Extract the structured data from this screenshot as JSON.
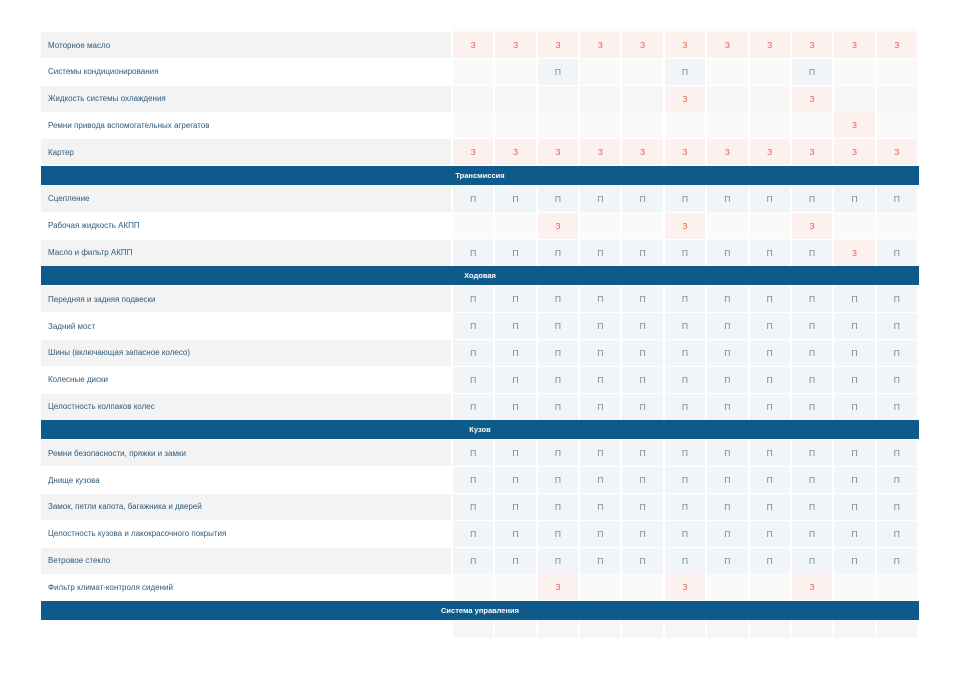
{
  "top_rows": [
    {
      "name": "Моторное масло",
      "shade": true,
      "cells": [
        "З",
        "З",
        "З",
        "З",
        "З",
        "З",
        "З",
        "З",
        "З",
        "З",
        "З"
      ]
    },
    {
      "name": "Системы кондиционирования",
      "shade": false,
      "cells": [
        "",
        "",
        "П",
        "",
        "",
        "П",
        "",
        "",
        "П",
        "",
        ""
      ]
    },
    {
      "name": "Жидкость системы охлаждения",
      "shade": true,
      "cells": [
        "",
        "",
        "",
        "",
        "",
        "З",
        "",
        "",
        "З",
        "",
        ""
      ]
    },
    {
      "name": "Ремни привода вспомогательных агрегатов",
      "shade": false,
      "cells": [
        "",
        "",
        "",
        "",
        "",
        "",
        "",
        "",
        "",
        "З",
        ""
      ]
    },
    {
      "name": "Картер",
      "shade": true,
      "cells": [
        "З",
        "З",
        "З",
        "З",
        "З",
        "З",
        "З",
        "З",
        "З",
        "З",
        "З"
      ]
    }
  ],
  "sections": [
    {
      "title": "Трансмиссия",
      "rows": [
        {
          "name": "Сцепление",
          "shade": true,
          "cells": [
            "П",
            "П",
            "П",
            "П",
            "П",
            "П",
            "П",
            "П",
            "П",
            "П",
            "П"
          ]
        },
        {
          "name": "Рабочая жидкость АКПП",
          "shade": false,
          "cells": [
            "",
            "",
            "З",
            "",
            "",
            "З",
            "",
            "",
            "З",
            "",
            ""
          ]
        },
        {
          "name": "Масло и фильтр АКПП",
          "shade": true,
          "cells": [
            "П",
            "П",
            "П",
            "П",
            "П",
            "П",
            "П",
            "П",
            "П",
            "З",
            "П"
          ]
        }
      ]
    },
    {
      "title": "Ходовая",
      "rows": [
        {
          "name": "Передняя и задняя подвески",
          "shade": true,
          "cells": [
            "П",
            "П",
            "П",
            "П",
            "П",
            "П",
            "П",
            "П",
            "П",
            "П",
            "П"
          ]
        },
        {
          "name": "Задний мост",
          "shade": false,
          "cells": [
            "П",
            "П",
            "П",
            "П",
            "П",
            "П",
            "П",
            "П",
            "П",
            "П",
            "П"
          ]
        },
        {
          "name": "Шины (включающая запасное колесо)",
          "shade": true,
          "cells": [
            "П",
            "П",
            "П",
            "П",
            "П",
            "П",
            "П",
            "П",
            "П",
            "П",
            "П"
          ]
        },
        {
          "name": "Колесные диски",
          "shade": false,
          "cells": [
            "П",
            "П",
            "П",
            "П",
            "П",
            "П",
            "П",
            "П",
            "П",
            "П",
            "П"
          ]
        },
        {
          "name": "Целостность колпаков колес",
          "shade": true,
          "cells": [
            "П",
            "П",
            "П",
            "П",
            "П",
            "П",
            "П",
            "П",
            "П",
            "П",
            "П"
          ]
        }
      ]
    },
    {
      "title": "Кузов",
      "rows": [
        {
          "name": "Ремни безопасности, пряжки и замки",
          "shade": true,
          "cells": [
            "П",
            "П",
            "П",
            "П",
            "П",
            "П",
            "П",
            "П",
            "П",
            "П",
            "П"
          ]
        },
        {
          "name": "Днище кузова",
          "shade": false,
          "cells": [
            "П",
            "П",
            "П",
            "П",
            "П",
            "П",
            "П",
            "П",
            "П",
            "П",
            "П"
          ]
        },
        {
          "name": "Замок, петли капота, багажника и дверей",
          "shade": true,
          "cells": [
            "П",
            "П",
            "П",
            "П",
            "П",
            "П",
            "П",
            "П",
            "П",
            "П",
            "П"
          ]
        },
        {
          "name": "Целостность кузова и лакокрасочного покрытия",
          "shade": false,
          "cells": [
            "П",
            "П",
            "П",
            "П",
            "П",
            "П",
            "П",
            "П",
            "П",
            "П",
            "П"
          ]
        },
        {
          "name": "Ветровое стекло",
          "shade": true,
          "cells": [
            "П",
            "П",
            "П",
            "П",
            "П",
            "П",
            "П",
            "П",
            "П",
            "П",
            "П"
          ]
        },
        {
          "name": "Фильтр климат-контроля сидений",
          "shade": false,
          "cells": [
            "",
            "",
            "З",
            "",
            "",
            "З",
            "",
            "",
            "З",
            "",
            ""
          ]
        }
      ]
    },
    {
      "title": "Система управления",
      "rows": []
    }
  ],
  "colors": {
    "section_bg": "#0e5a8a",
    "replace_text": "#e35a4b",
    "check_text": "#6e8597",
    "label_text": "#2e5a7c"
  }
}
